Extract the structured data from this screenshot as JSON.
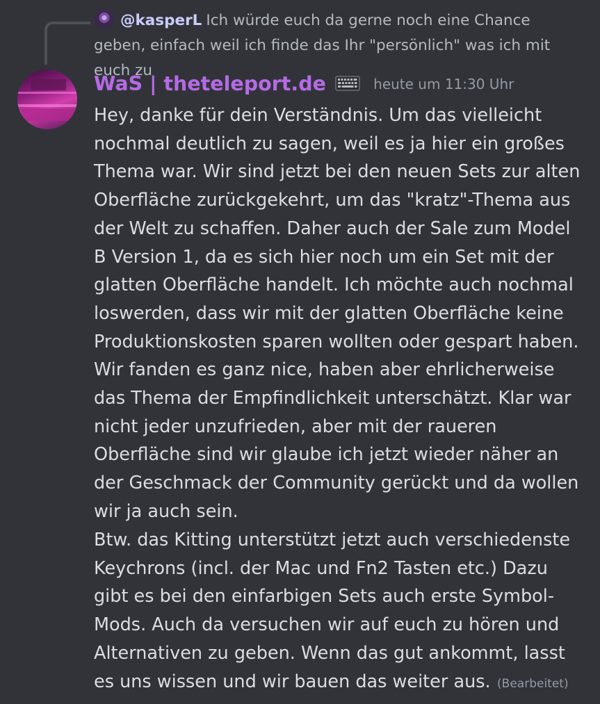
{
  "reply": {
    "author": "@kasperL",
    "text": "Ich würde euch da gerne noch eine Chance geben, einfach weil ich finde das Ihr \"persönlich\" was ich mit euch zu"
  },
  "message": {
    "author": "WaS | theteleport.de",
    "badge_icon": "keyboard-icon",
    "timestamp": "heute um 11:30 Uhr",
    "paragraph1": "Hey, danke für dein Verständnis. Um das vielleicht nochmal deutlich zu sagen, weil es ja hier ein großes Thema war. Wir sind jetzt bei den neuen Sets zur alten Oberfläche zurückgekehrt, um das \"kratz\"-Thema aus der Welt zu schaffen. Daher auch der Sale zum Model B Version 1, da es sich hier noch um ein Set mit der glatten Oberfläche handelt. Ich möchte auch nochmal loswerden, dass wir mit der glatten Oberfläche keine Produktionskosten sparen wollten oder gespart haben. Wir fanden es ganz nice, haben aber ehrlicherweise das Thema der Empfindlichkeit unterschätzt. Klar war nicht jeder unzufrieden, aber mit der raueren Oberfläche sind wir glaube ich jetzt wieder näher an der Geschmack der Community gerückt und da wollen wir ja auch sein.",
    "paragraph2": "Btw. das Kitting unterstützt jetzt auch verschiedenste Keychrons (incl. der Mac und Fn2 Tasten etc.) Dazu gibt es bei den einfarbigen Sets auch erste Symbol-Mods. Auch da versuchen wir auf euch zu hören und Alternativen zu geben. Wenn das gut ankommt, lasst es uns wissen und wir bauen das weiter aus.",
    "edited_label": "(Bearbeitet)"
  },
  "colors": {
    "background": "#313338",
    "username": "#b56ae6",
    "reply_author": "#c9cdfb",
    "text": "#dbdee1",
    "muted": "#949ba4"
  }
}
